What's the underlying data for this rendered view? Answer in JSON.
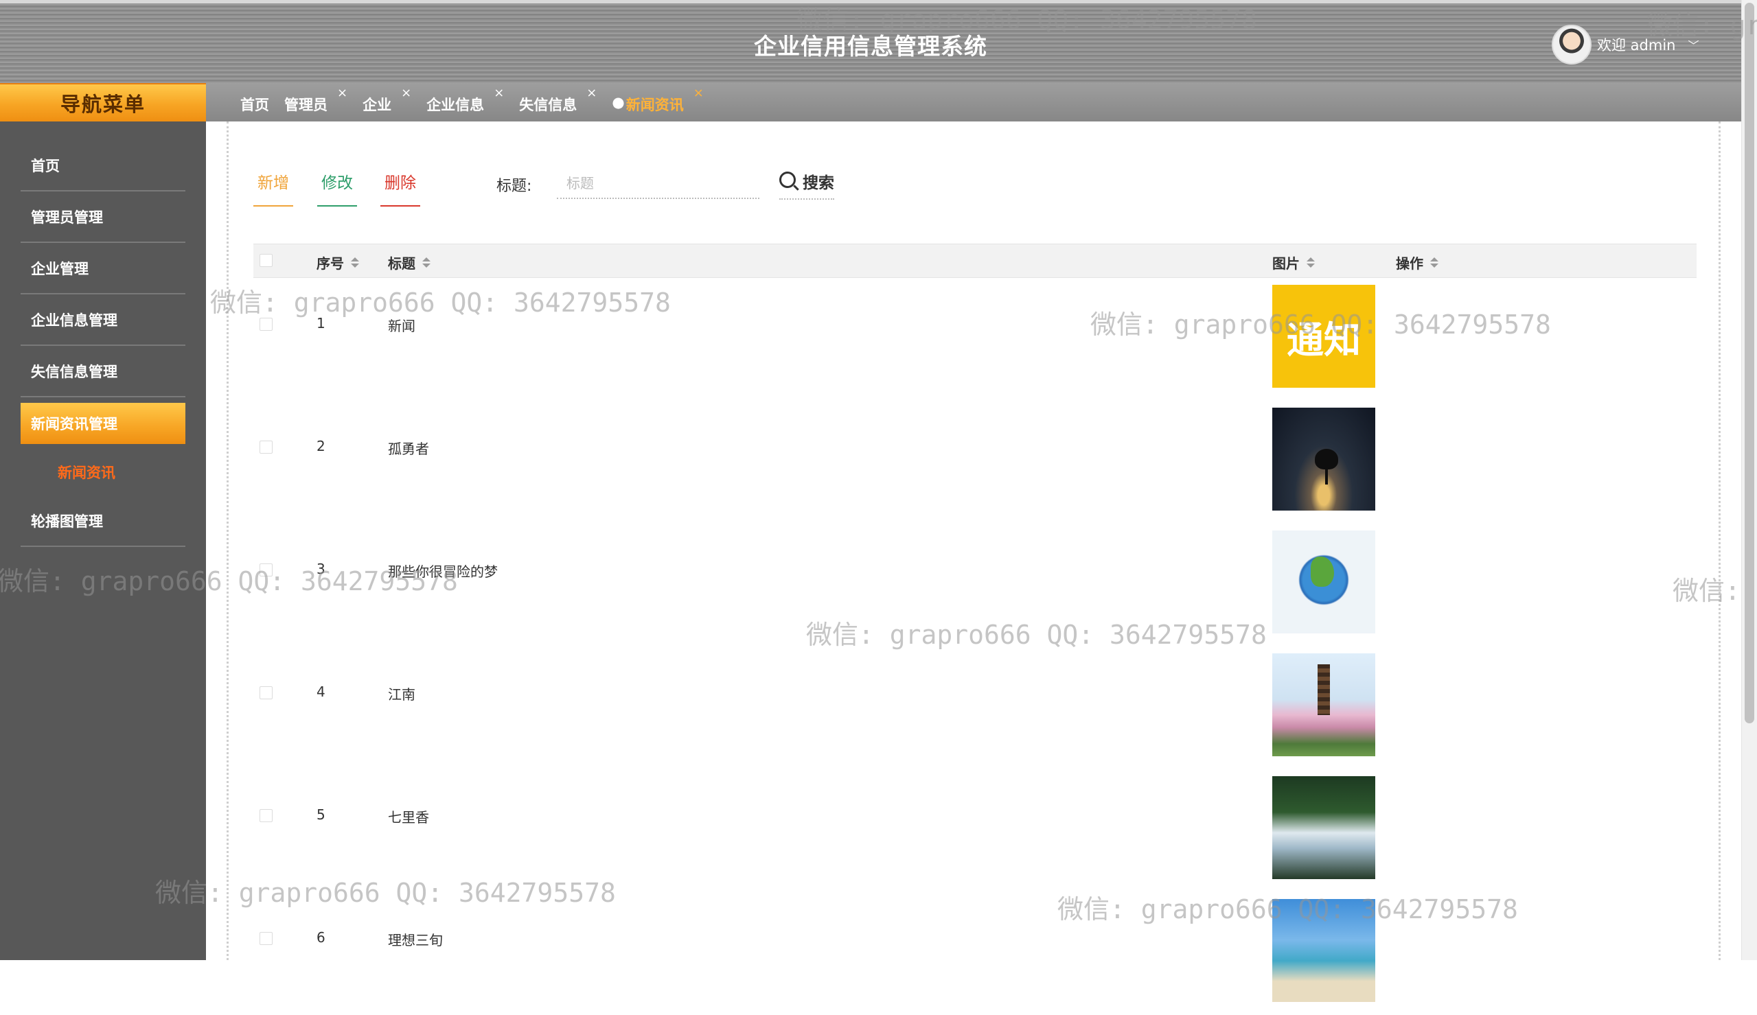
{
  "header": {
    "title": "企业信用信息管理系统",
    "welcome": "欢迎 admin",
    "caret": "﹀"
  },
  "nav_title": "导航菜单",
  "tabs": [
    {
      "label": "首页",
      "closable": false
    },
    {
      "label": "管理员",
      "closable": true
    },
    {
      "label": "企业",
      "closable": true
    },
    {
      "label": "企业信息",
      "closable": true
    },
    {
      "label": "失信信息",
      "closable": true
    },
    {
      "label": "新闻资讯",
      "closable": true,
      "active": true
    }
  ],
  "tab_close": "×",
  "tab_dot": "●",
  "sidebar": {
    "items": [
      {
        "label": "首页"
      },
      {
        "label": "管理员管理"
      },
      {
        "label": "企业管理"
      },
      {
        "label": "企业信息管理"
      },
      {
        "label": "失信信息管理"
      },
      {
        "label": "新闻资讯管理",
        "active": true
      },
      {
        "label": "轮播图管理"
      }
    ],
    "sub_item": "新闻资讯"
  },
  "toolbar": {
    "add": "新增",
    "edit": "修改",
    "delete": "删除",
    "search_label": "标题:",
    "search_placeholder": "标题",
    "search_button": "搜索"
  },
  "table": {
    "columns": [
      "序号",
      "标题",
      "图片",
      "操作"
    ],
    "rows": [
      {
        "index": "1",
        "title": "新闻",
        "pic_text": "通知"
      },
      {
        "index": "2",
        "title": "孤勇者",
        "pic_text": ""
      },
      {
        "index": "3",
        "title": "那些你很冒险的梦",
        "pic_text": ""
      },
      {
        "index": "4",
        "title": "江南",
        "pic_text": ""
      },
      {
        "index": "5",
        "title": "七里香",
        "pic_text": ""
      },
      {
        "index": "6",
        "title": "理想三旬",
        "pic_text": ""
      }
    ]
  },
  "watermark": "微信: grapro666 QQ: 3642795578",
  "watermark_fragments": {
    "left": "微信: grapro666 QQ: 3642795578",
    "right_top": "微信: gr",
    "right_mid": "微信:"
  },
  "colors": {
    "accent_orange": "#f7a524",
    "add_color": "#f0a43a",
    "edit_color": "#2e9e6a",
    "delete_color": "#d9382c",
    "sub_item_color": "#ff6a1a"
  }
}
